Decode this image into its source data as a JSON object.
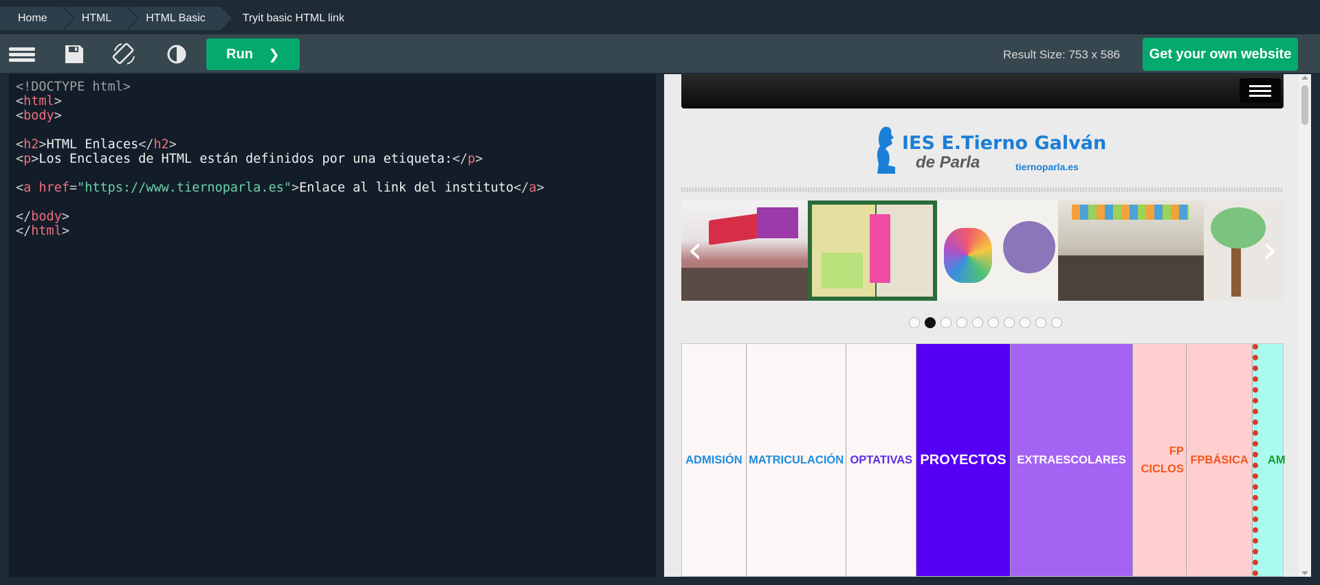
{
  "breadcrumb": {
    "items": [
      "Home",
      "HTML",
      "HTML Basic",
      "Tryit basic HTML link"
    ]
  },
  "toolbar": {
    "run_label": "Run",
    "run_arrow": "❯",
    "result_size": "Result Size: 753 x 586",
    "get_site_label": "Get your own website",
    "accent_color": "#04aa6d"
  },
  "editor": {
    "lines": {
      "l1": "<!DOCTYPE html>",
      "l2_tag": "html",
      "l3_tag": "body",
      "l5_tag": "h2",
      "l5_text": "HTML Enlaces",
      "l6_tag": "p",
      "l6_text": "Los Enclaces de HTML están definidos por una etiqueta:",
      "l8_tag": "a",
      "l8_attr": "href",
      "l8_value": "\"https://www.tiernoparla.es\"",
      "l8_text": "Enlace al link del instituto",
      "l10_tag": "body",
      "l11_tag": "html"
    }
  },
  "result": {
    "logo": {
      "title": "IES E.Tierno Galván",
      "subtitle": "de Parla",
      "url": "tiernoparla.es"
    },
    "slider": {
      "prev_icon": "chevron-left-icon",
      "next_icon": "chevron-right-icon",
      "dots_count": 10,
      "active_dot": 1
    },
    "menu": [
      {
        "label": "ADMISIÓN",
        "color": "#1b8ddb",
        "bg": "#fdf6f6"
      },
      {
        "label": "MATRICULACIÓN",
        "color": "#1b8ddb",
        "bg": "#fdf6f6"
      },
      {
        "label": "OPTATIVAS",
        "color": "#5b2ee0",
        "bg": "#fdf6f6"
      },
      {
        "label": "PROYECTOS",
        "color": "#ffffff",
        "bg": "#5500f5"
      },
      {
        "label": "EXTRAESCOLARES",
        "color": "#ffffff",
        "bg": "#a463f2"
      },
      {
        "label": "FP CICLOS",
        "color": "#f1561c",
        "bg": "#ffcfcf"
      },
      {
        "label": "FPBÁSICA",
        "color": "#f1561c",
        "bg": "#ffcfcf"
      },
      {
        "label": "AM",
        "color": "#1a9b2b",
        "bg": "#aafaf0"
      }
    ]
  }
}
